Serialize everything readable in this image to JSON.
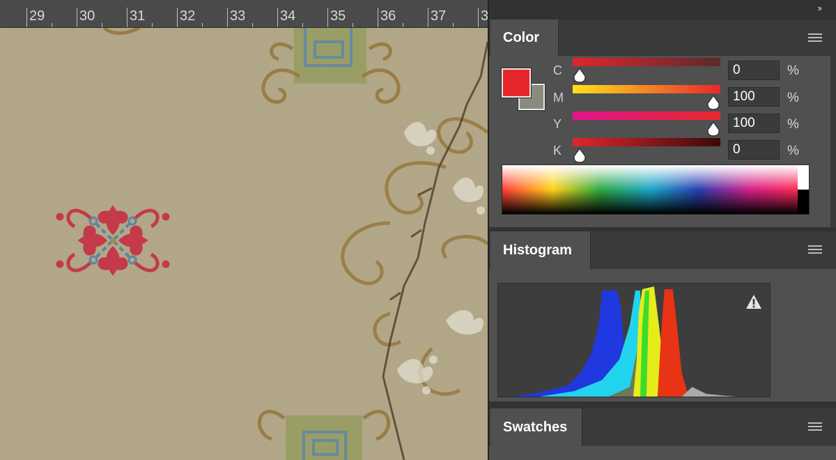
{
  "ruler": {
    "labels": [
      "29",
      "30",
      "31",
      "32",
      "33",
      "34",
      "35",
      "36",
      "37",
      "3"
    ]
  },
  "panels": {
    "collapse_label": "››",
    "color": {
      "title": "Color",
      "foreground": "#e6262a",
      "background": "#8a8b7f",
      "sliders": [
        {
          "label": "C",
          "value": "0",
          "unit": "%",
          "level": 0
        },
        {
          "label": "M",
          "value": "100",
          "unit": "%",
          "level": 100
        },
        {
          "label": "Y",
          "value": "100",
          "unit": "%",
          "level": 100
        },
        {
          "label": "K",
          "value": "0",
          "unit": "%",
          "level": 0
        }
      ]
    },
    "histogram": {
      "title": "Histogram",
      "warning_icon": "warning-triangle-icon"
    },
    "swatches": {
      "title": "Swatches"
    }
  }
}
